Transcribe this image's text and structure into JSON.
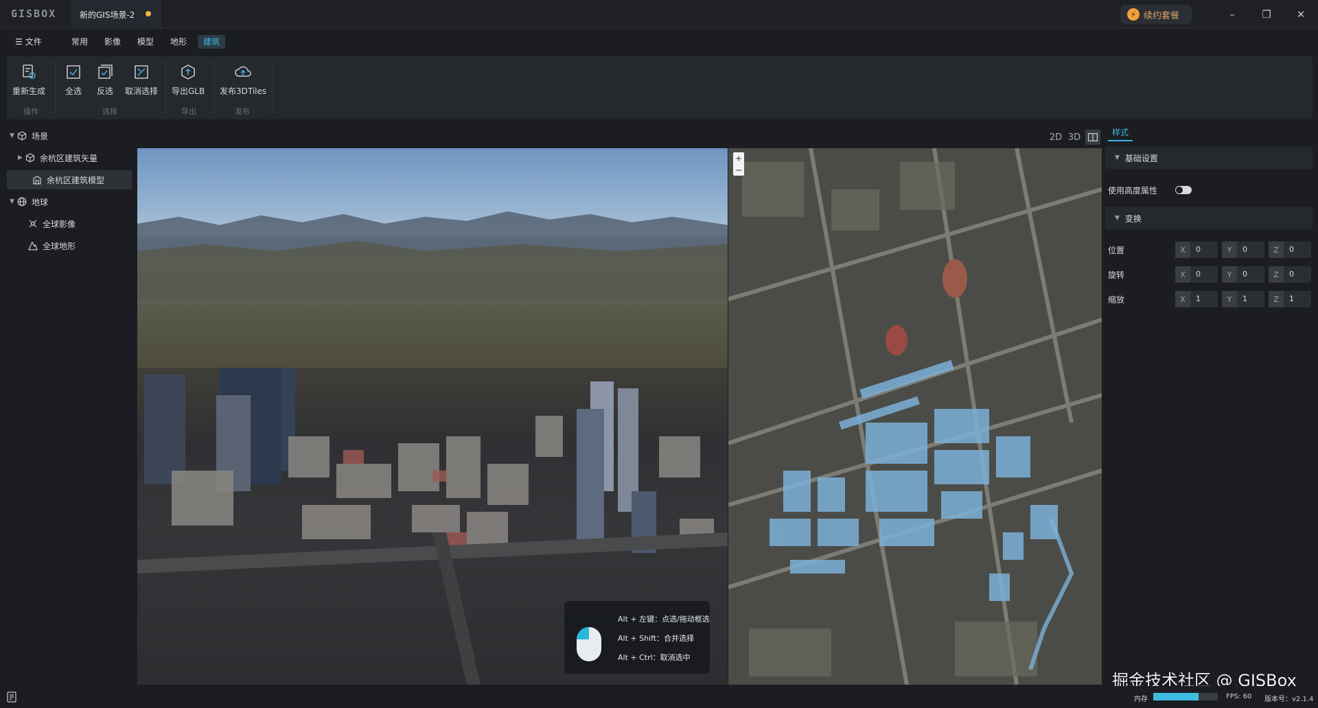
{
  "app": {
    "logo": "GISBOX",
    "doc_title": "新的GIS场景-2",
    "renew": "续约套餐"
  },
  "window": {
    "minimize": "–",
    "restore": "❐",
    "close": "✕"
  },
  "menu": {
    "file": "文件",
    "items": [
      "常用",
      "影像",
      "模型",
      "地形",
      "建筑"
    ],
    "active": "建筑"
  },
  "ribbon": {
    "buttons": [
      {
        "label": "重新生成",
        "icon": "regenerate-icon"
      },
      {
        "label": "全选",
        "icon": "select-all-icon"
      },
      {
        "label": "反选",
        "icon": "invert-select-icon"
      },
      {
        "label": "取消选择",
        "icon": "deselect-icon"
      },
      {
        "label": "导出GLB",
        "icon": "export-glb-icon"
      },
      {
        "label": "发布3DTiles",
        "icon": "cloud-upload-icon"
      }
    ],
    "groups": [
      "操作",
      "选择",
      "导出",
      "发布"
    ]
  },
  "tree": {
    "scene": "场景",
    "scene_children": [
      "余杭区建筑矢量",
      "余杭区建筑模型"
    ],
    "globe": "地球",
    "globe_children": [
      "全球影像",
      "全球地形"
    ]
  },
  "view_modes": [
    "2D",
    "3D"
  ],
  "help": {
    "lines": [
      "Alt + 左键：点选/拖动框选",
      "Alt + Shift：合并选择",
      "Alt + Ctrl：取消选中"
    ]
  },
  "zoom": {
    "in": "+",
    "out": "−"
  },
  "panel": {
    "tab": "样式",
    "basic_section": "基础设置",
    "use_height": "使用高度属性",
    "use_height_on": false,
    "transform_section": "变换",
    "position_label": "位置",
    "rotation_label": "旋转",
    "scale_label": "缩放",
    "position": {
      "X": "0",
      "Y": "0",
      "Z": "0"
    },
    "rotation": {
      "X": "0",
      "Y": "0",
      "Z": "0"
    },
    "scale": {
      "X": "1",
      "Y": "1",
      "Z": "1"
    }
  },
  "status": {
    "memory_label": "内存",
    "memory_fraction": 0.7,
    "fps": "FPS: 60",
    "version": "版本号：v2.1.4"
  },
  "watermark": "掘金技术社区 @ GISBox",
  "colors": {
    "accent": "#3fb7e0",
    "renew": "#f0a23a",
    "dot": "#f2b33d"
  }
}
